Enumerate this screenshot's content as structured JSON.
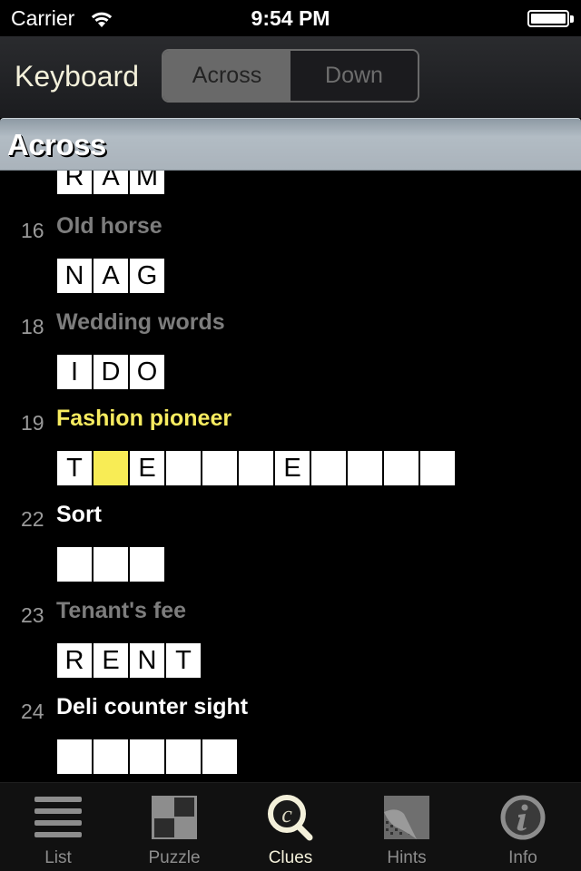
{
  "status_bar": {
    "carrier": "Carrier",
    "time": "9:54 PM",
    "wifi_icon": "wifi-icon",
    "battery_icon": "battery-full-icon"
  },
  "nav": {
    "title": "Keyboard",
    "segments": [
      {
        "label": "Across",
        "selected": true
      },
      {
        "label": "Down",
        "selected": false
      }
    ]
  },
  "section": {
    "title": "Across"
  },
  "colors": {
    "current_clue": "#f7ec60",
    "selected_cell": "#f8ec55",
    "solved_clue": "#7d7d7d",
    "open_clue": "#ffffff",
    "tab_active": "#f3f0da"
  },
  "clues": [
    {
      "number": "",
      "text": "",
      "state": "done",
      "cells": [
        "R",
        "A",
        "M"
      ],
      "partial": true
    },
    {
      "number": "16",
      "text": "Old horse",
      "state": "done",
      "cells": [
        "N",
        "A",
        "G"
      ]
    },
    {
      "number": "18",
      "text": "Wedding words",
      "state": "done",
      "cells": [
        "I",
        "D",
        "O"
      ]
    },
    {
      "number": "19",
      "text": "Fashion pioneer",
      "state": "current",
      "cells": [
        "T",
        "",
        "E",
        "",
        "",
        "",
        "E",
        "",
        "",
        "",
        ""
      ],
      "selected_cell_index": 1
    },
    {
      "number": "22",
      "text": "Sort",
      "state": "open",
      "cells": [
        "",
        "",
        ""
      ]
    },
    {
      "number": "23",
      "text": "Tenant's fee",
      "state": "done",
      "cells": [
        "R",
        "E",
        "N",
        "T"
      ]
    },
    {
      "number": "24",
      "text": "Deli counter sight",
      "state": "open",
      "cells": [
        "",
        "",
        "",
        "",
        ""
      ]
    }
  ],
  "tabs": [
    {
      "label": "List",
      "icon": "list-icon",
      "active": false
    },
    {
      "label": "Puzzle",
      "icon": "puzzle-grid-icon",
      "active": false
    },
    {
      "label": "Clues",
      "icon": "clues-magnifier-icon",
      "active": true
    },
    {
      "label": "Hints",
      "icon": "hints-page-curl-icon",
      "active": false
    },
    {
      "label": "Info",
      "icon": "info-icon",
      "active": false
    }
  ]
}
